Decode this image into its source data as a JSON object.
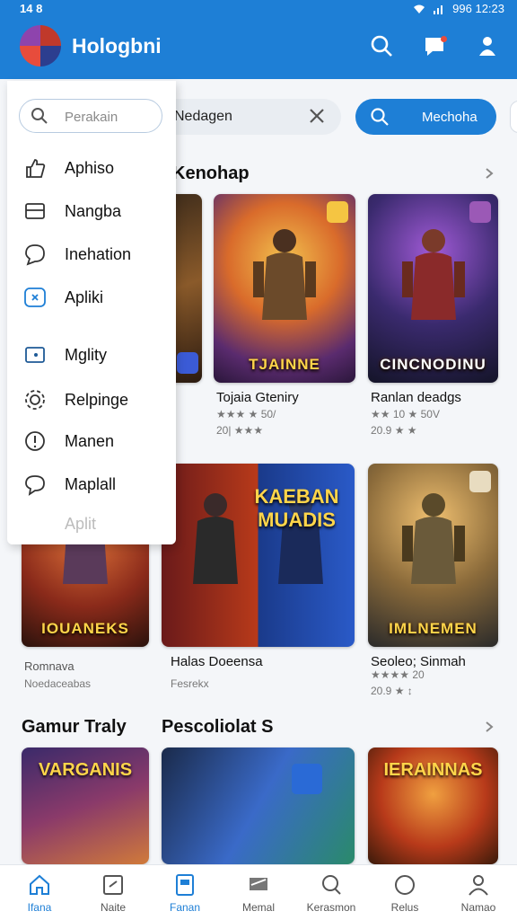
{
  "status_bar": {
    "time": "14 8",
    "right_text": "996 12:23"
  },
  "app": {
    "name": "Hologbni"
  },
  "search": {
    "value": "Nedagen",
    "button_label": "Mechoha"
  },
  "drawer": {
    "search_placeholder": "Perakain",
    "items": [
      {
        "label": "Aphiso",
        "icon": "thumb-icon"
      },
      {
        "label": "Nangba",
        "icon": "card-icon"
      },
      {
        "label": "Inehation",
        "icon": "chat-icon"
      },
      {
        "label": "Apliki",
        "icon": "app-icon"
      },
      {
        "label": "Mglity",
        "icon": "image-icon"
      },
      {
        "label": "Relpinge",
        "icon": "gear-icon"
      },
      {
        "label": "Manen",
        "icon": "info-icon"
      },
      {
        "label": "Maplall",
        "icon": "bubble-icon"
      },
      {
        "label": "Aplit",
        "icon": ""
      }
    ]
  },
  "sections": [
    {
      "title": "Kenohap"
    },
    {
      "title": "Gamur Traly"
    },
    {
      "title": "Pescoliolat S"
    }
  ],
  "cards": [
    {
      "title": "",
      "meta1": "",
      "meta2": "",
      "art_text": ""
    },
    {
      "title": "Tojaia Gteniry",
      "meta1": "★★★ ★ 50/",
      "meta2": "20| ★★★",
      "art_text": "TJAINNE"
    },
    {
      "title": "Ranlan deadgs",
      "meta1": "★★ 10 ★ 50V",
      "meta2": "20.9 ★ ★",
      "art_text": "CINCNODINU"
    },
    {
      "title": "Romnava",
      "meta1": "Noedaceabas",
      "meta2": "",
      "art_text": "IOUANEKS"
    },
    {
      "title": "Halas Doeensa",
      "meta1": "Fesrekx",
      "meta2": "",
      "art_text": "KAEBAN MUADIS"
    },
    {
      "title": "Seoleo; Sinmah",
      "meta1": "★★★★ 20",
      "meta2": "20.9 ★ ↕",
      "art_text": "IMLNEMEN"
    },
    {
      "title": "",
      "meta1": "",
      "meta2": "",
      "art_text": "VARGANIS"
    },
    {
      "title": "",
      "meta1": "",
      "meta2": "",
      "art_text": ""
    },
    {
      "title": "",
      "meta1": "",
      "meta2": "",
      "art_text": "IERAINNAS"
    }
  ],
  "bottom_nav": [
    {
      "label": "Ifana",
      "icon": "home-icon"
    },
    {
      "label": "Naite",
      "icon": "tablet-icon"
    },
    {
      "label": "Fanan",
      "icon": "library-icon"
    },
    {
      "label": "Memal",
      "icon": "send-icon"
    },
    {
      "label": "Kerasmon",
      "icon": "search-icon"
    },
    {
      "label": "Relus",
      "icon": "circle-icon"
    },
    {
      "label": "Namao",
      "icon": "profile-icon"
    }
  ],
  "colors": {
    "primary": "#1e7fd6",
    "badge": "#f5c542"
  }
}
